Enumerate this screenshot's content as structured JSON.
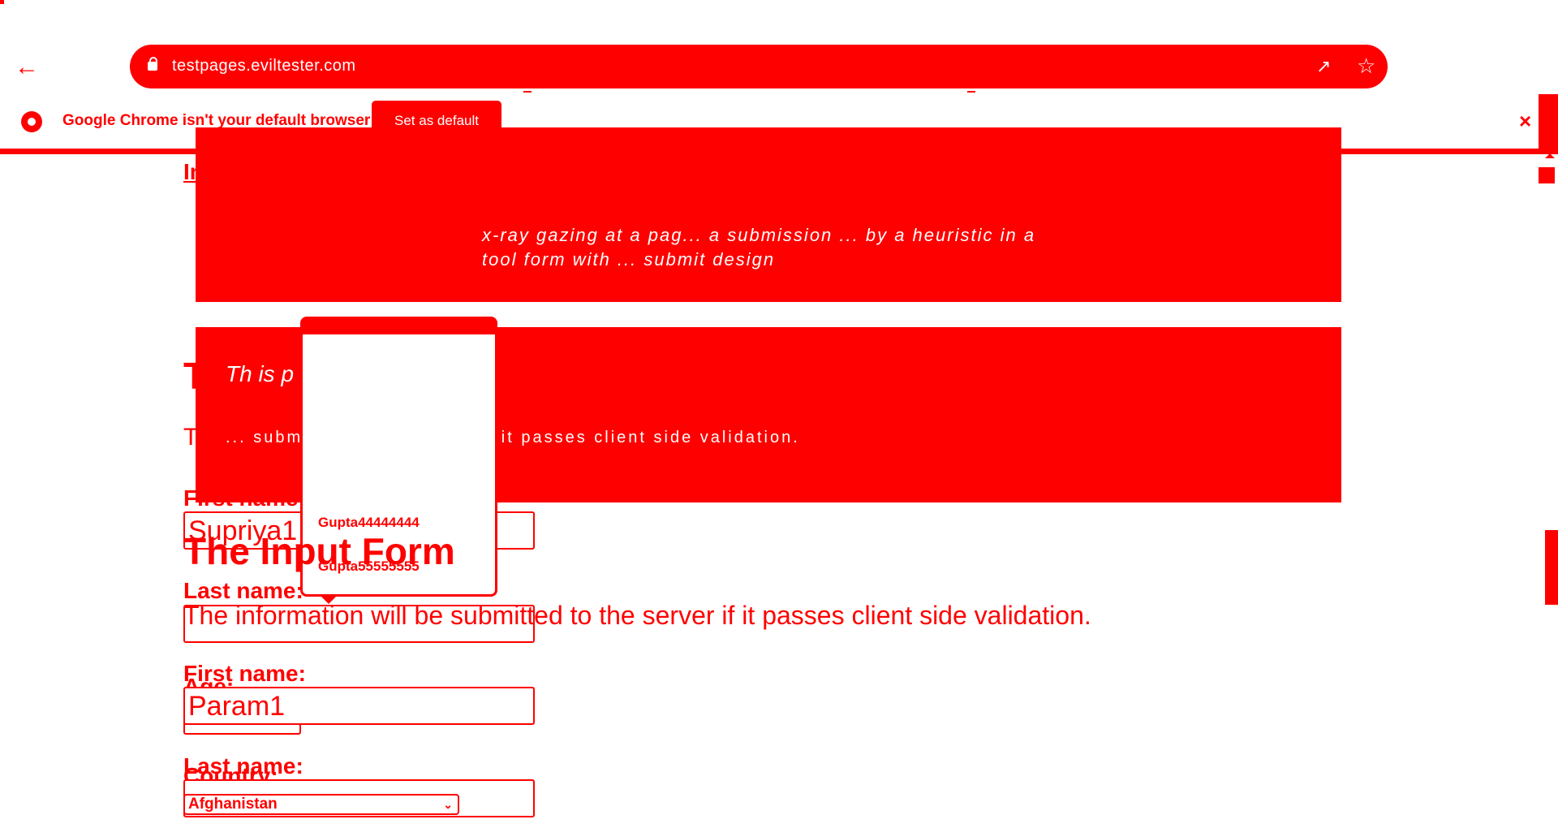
{
  "colors": {
    "accent": "#ff0000",
    "background": "#ffffff"
  },
  "browser": {
    "back_icon": "arrow-left-icon",
    "url": "testpages.eviltester.com",
    "share_icon": "share-icon",
    "bookmark_icon": "star-icon"
  },
  "infobar": {
    "message": "Google Chrome isn't your default browser",
    "set_default_label": "Set as default",
    "close_label": "×"
  },
  "background_page": {
    "link_text": "In",
    "heading": "Th",
    "description": "Th",
    "first_name_label": "First name:",
    "first_name_value": "Supriya1",
    "last_name_label": "Last name:",
    "age_label": "Age:",
    "country_label": "Country:"
  },
  "overlay": {
    "panel1_text": "x-ray gazing at a pag... a submission ... by a heuristic in a tool form with ... submit design",
    "panel2_text1": "Th is p",
    "panel2_text2": "... submitted to the server if it passes client side validation."
  },
  "autocomplete": {
    "items": [
      "Gupta44444444",
      "Gupta55555555"
    ]
  },
  "form": {
    "heading": "The Input Form",
    "description": "The information will be submitted to the server if it passes client side validation.",
    "first_name_label": "First name:",
    "first_name_value": "Param1",
    "last_name_label": "Last name:",
    "last_name_value": "",
    "country_selected": "Afghanistan"
  }
}
